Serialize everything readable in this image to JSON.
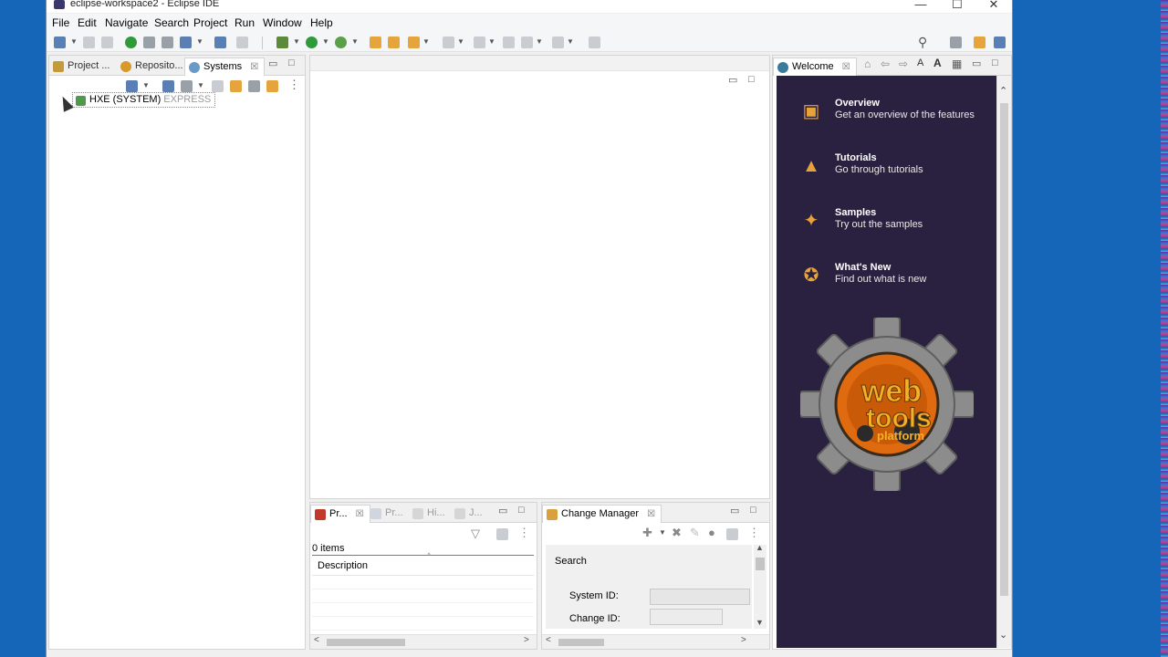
{
  "window": {
    "title": "eclipse-workspace2 - Eclipse IDE",
    "controls": [
      "—",
      "☐",
      "✕"
    ]
  },
  "menu": [
    "File",
    "Edit",
    "Navigate",
    "Search",
    "Project",
    "Run",
    "Window",
    "Help"
  ],
  "left_panel": {
    "tabs": [
      {
        "label": "Project ..."
      },
      {
        "label": "Reposito..."
      },
      {
        "label": "Systems",
        "close": "☒"
      }
    ],
    "tree": {
      "system": "HXE (SYSTEM)",
      "tag": "EXPRESS"
    }
  },
  "problems_panel": {
    "tabs": [
      {
        "label": "Pr...",
        "close": "☒"
      },
      {
        "label": "Pr..."
      },
      {
        "label": "Hi..."
      },
      {
        "label": "J..."
      }
    ],
    "items_count": "0 items",
    "column": "Description"
  },
  "change_manager": {
    "tab": "Change Manager",
    "close": "☒",
    "section": "Search",
    "fields": [
      {
        "label": "System ID:",
        "value": ""
      },
      {
        "label": "Change ID:",
        "value": ""
      }
    ]
  },
  "welcome": {
    "tab": "Welcome",
    "close": "☒",
    "items": [
      {
        "title": "Overview",
        "desc": "Get an overview of the features",
        "icon": "map-icon"
      },
      {
        "title": "Tutorials",
        "desc": "Go through tutorials",
        "icon": "graduation-cap-icon"
      },
      {
        "title": "Samples",
        "desc": "Try out the samples",
        "icon": "magic-wand-icon"
      },
      {
        "title": "What's New",
        "desc": "Find out what is new",
        "icon": "star-icon"
      }
    ],
    "logo": {
      "line1": "web",
      "line2": "tools",
      "line3": "platform"
    }
  },
  "colors": {
    "welcome_bg": "#2a2140",
    "accent_orange": "#e8a23a",
    "desktop": "#1565b8"
  }
}
